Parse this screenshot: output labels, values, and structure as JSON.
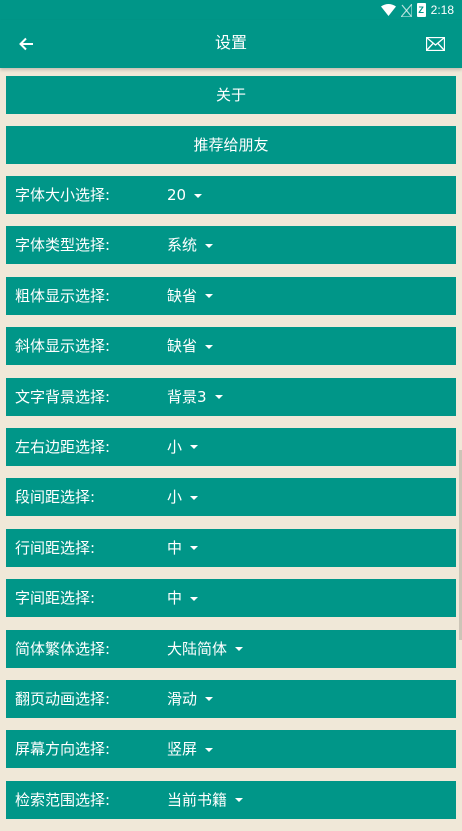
{
  "status": {
    "time": "2:18",
    "battery_text": "Z"
  },
  "header": {
    "title": "设置"
  },
  "buttons": {
    "about": "关于",
    "recommend": "推荐给朋友"
  },
  "options": [
    {
      "label": "字体大小选择:",
      "value": "20"
    },
    {
      "label": "字体类型选择:",
      "value": "系统"
    },
    {
      "label": "粗体显示选择:",
      "value": "缺省"
    },
    {
      "label": "斜体显示选择:",
      "value": "缺省"
    },
    {
      "label": "文字背景选择:",
      "value": "背景3"
    },
    {
      "label": "左右边距选择:",
      "value": "小"
    },
    {
      "label": "段间距选择:",
      "value": "小"
    },
    {
      "label": "行间距选择:",
      "value": "中"
    },
    {
      "label": "字间距选择:",
      "value": "中"
    },
    {
      "label": "简体繁体选择:",
      "value": "大陆简体"
    },
    {
      "label": "翻页动画选择:",
      "value": "滑动"
    },
    {
      "label": "屏幕方向选择:",
      "value": "竖屏"
    },
    {
      "label": "检索范围选择:",
      "value": "当前书籍"
    }
  ],
  "colors": {
    "primary": "#009688",
    "background": "#f0e8d8",
    "text": "#ffffff"
  },
  "icons": {
    "wifi": "wifi-icon",
    "signal": "no-signal-icon",
    "battery": "battery-icon",
    "back": "arrow-back-icon",
    "mail": "mail-icon"
  }
}
